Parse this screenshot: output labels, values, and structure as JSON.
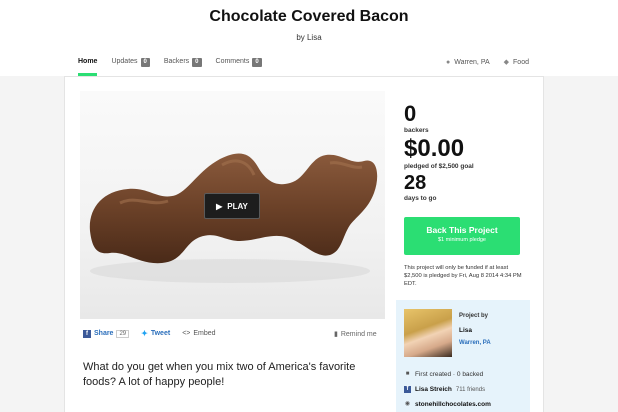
{
  "header": {
    "title": "Chocolate Covered Bacon",
    "byline": "by Lisa"
  },
  "tabs": [
    {
      "label": "Home",
      "active": true
    },
    {
      "label": "Updates",
      "count": "0"
    },
    {
      "label": "Backers",
      "count": "0"
    },
    {
      "label": "Comments",
      "count": "0"
    }
  ],
  "meta": {
    "location": "Warren, PA",
    "category": "Food"
  },
  "video": {
    "play_label": "PLAY"
  },
  "social": {
    "share_label": "Share",
    "share_count": "29",
    "tweet_label": "Tweet",
    "embed_label": "Embed",
    "remind_label": "Remind me"
  },
  "description": "What do you get when you mix two of America's favorite foods? A lot of happy people!",
  "stats": {
    "backers_value": "0",
    "backers_label": "backers",
    "pledged_value": "$0.00",
    "pledged_label": "pledged of $2,500 goal",
    "days_value": "28",
    "days_label": "days to go"
  },
  "back_button": {
    "label": "Back This Project",
    "sublabel": "$1 minimum pledge"
  },
  "funding_note": "This project will only be funded if at least $2,500 is pledged by Fri, Aug 8 2014 4:34 PM EDT.",
  "creator": {
    "project_by": "Project by",
    "name": "Lisa",
    "location": "Warren, PA",
    "history": "First created · 0 backed",
    "facebook_name": "Lisa Streich",
    "facebook_friends": "711 friends",
    "website": "stonehillchocolates.com"
  },
  "colors": {
    "accent": "#2bde73",
    "link": "#2a6ebb",
    "creator_bg": "#e6f3fb"
  }
}
